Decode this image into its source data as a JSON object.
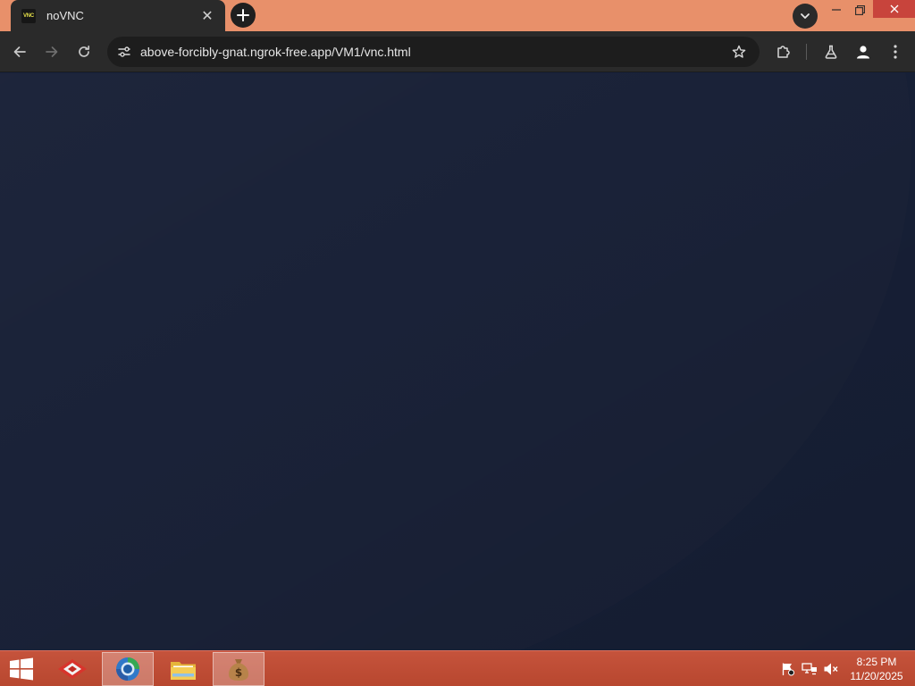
{
  "browser": {
    "tab": {
      "title": "noVNC",
      "favicon_text": "VNC",
      "close_symbol": "✕"
    },
    "toolbar": {
      "url": "above-forcibly-gnat.ngrok-free.app/VM1/vnc.html"
    },
    "icons": {
      "new_tab": "plus-icon",
      "tab_search": "chevron-down-icon",
      "back": "arrow-left-icon",
      "forward": "arrow-right-icon",
      "reload": "reload-icon",
      "site_info": "tune-icon",
      "bookmark": "star-icon",
      "extensions": "puzzle-icon",
      "labs": "flask-icon",
      "profile": "person-icon",
      "menu": "kebab-menu-icon"
    }
  },
  "taskbar": {
    "apps": [
      {
        "name": "diamond-app-icon"
      },
      {
        "name": "browser-app-icon",
        "active": true
      },
      {
        "name": "file-explorer-icon"
      },
      {
        "name": "money-bag-icon",
        "active": true
      }
    ],
    "tray": [
      "flag-icon",
      "network-icon",
      "volume-muted-icon"
    ],
    "clock": {
      "time": "8:25 PM",
      "date": "11/20/2025"
    }
  },
  "colors": {
    "tab_strip": "#e8906a",
    "browser_chrome": "#2a2a2a",
    "desktop": "#172037",
    "taskbar": "#c5533c",
    "close_button": "#c8443c"
  }
}
